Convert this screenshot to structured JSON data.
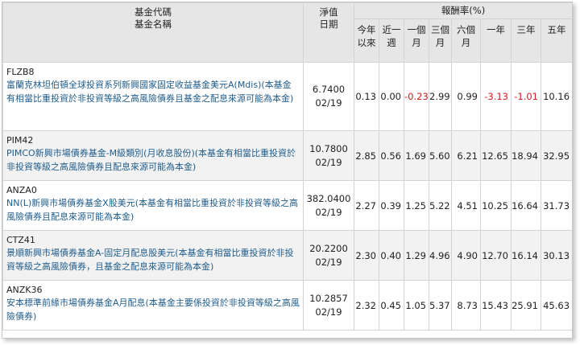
{
  "header": {
    "fund_code": "基金代碼",
    "fund_name": "基金名稱",
    "nav": "淨值",
    "date": "日期",
    "returns": "報酬率(%)",
    "periods": [
      "今年以來",
      "近一週",
      "一個月",
      "三個月",
      "六個月",
      "一年",
      "三年",
      "五年"
    ]
  },
  "rows": [
    {
      "code": "FLZB8",
      "name": "富蘭克林坦伯頓全球投資系列新興國家固定收益基金美元A(Mdis)(本基金有相當比重投資於非投資等級之高風險債券且基金之配息來源可能為本金)",
      "nav": "6.7400",
      "date": "02/19",
      "returns": [
        "0.13",
        "0.00",
        "-0.23",
        "2.99",
        "0.99",
        "-3.13",
        "-1.01",
        "10.16"
      ]
    },
    {
      "code": "PIM42",
      "name": "PIMCO新興市場債券基金-M級類別(月收息股份)(本基金有相當比重投資於非投資等級之高風險債券且配息來源可能為本金)",
      "nav": "10.7800",
      "date": "02/19",
      "returns": [
        "2.85",
        "0.56",
        "1.69",
        "5.60",
        "6.21",
        "12.65",
        "18.94",
        "32.95"
      ]
    },
    {
      "code": "ANZA0",
      "name": "NN(L)新興市場債券基金X股美元(本基金有相當比重投資於非投資等級之高風險債券且配息來源可能為本金)",
      "nav": "382.0400",
      "date": "02/19",
      "returns": [
        "2.27",
        "0.39",
        "1.25",
        "5.22",
        "4.51",
        "10.25",
        "16.64",
        "31.73"
      ]
    },
    {
      "code": "CTZ41",
      "name": "景順新興市場債券基金A-固定月配息股美元(本基金有相當比重投資於非投資等級之高風險債券，且基金之配息來源可能為本金)",
      "nav": "20.2200",
      "date": "02/19",
      "returns": [
        "2.30",
        "0.40",
        "1.29",
        "4.96",
        "4.90",
        "12.70",
        "16.14",
        "30.13"
      ]
    },
    {
      "code": "ANZK36",
      "name": "安本標準前緣市場債券基金A月配息(本基金主要係投資於非投資等級之高風險債券)",
      "nav": "10.2857",
      "date": "02/19",
      "returns": [
        "2.32",
        "0.45",
        "1.05",
        "5.37",
        "8.73",
        "15.43",
        "25.91",
        "45.63"
      ]
    }
  ],
  "colors": {
    "header_bg": "#e6e6e6",
    "link": "#1f5c8b",
    "negative": "#d71920",
    "alt_row": "#f2f2f2"
  }
}
